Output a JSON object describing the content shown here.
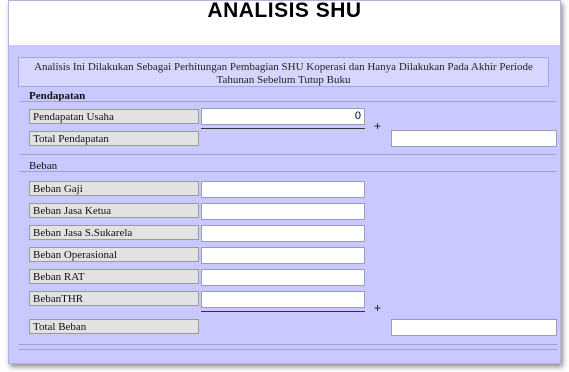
{
  "title": "ANALISIS SHU",
  "description": "Analisis Ini Dilakukan Sebagai Perhitungan Pembagian SHU Koperasi dan Hanya Dilakukan Pada Akhir Periode Tahunan Sebelum Tutup Buku",
  "pendapatan": {
    "section_label": "Pendapatan",
    "rows": [
      {
        "label": "Pendapatan Usaha",
        "value": "0"
      }
    ],
    "plus": "+",
    "total_label": "Total Pendapatan",
    "total_value": ""
  },
  "beban": {
    "section_label": "Beban",
    "rows": [
      {
        "label": "Beban Gaji",
        "value": ""
      },
      {
        "label": "Beban Jasa Ketua",
        "value": ""
      },
      {
        "label": "Beban Jasa S.Sukarela",
        "value": ""
      },
      {
        "label": "Beban Operasional",
        "value": ""
      },
      {
        "label": "Beban RAT",
        "value": ""
      },
      {
        "label": "BebanTHR",
        "value": ""
      }
    ],
    "plus": "+",
    "total_label": "Total Beban",
    "total_value": ""
  }
}
